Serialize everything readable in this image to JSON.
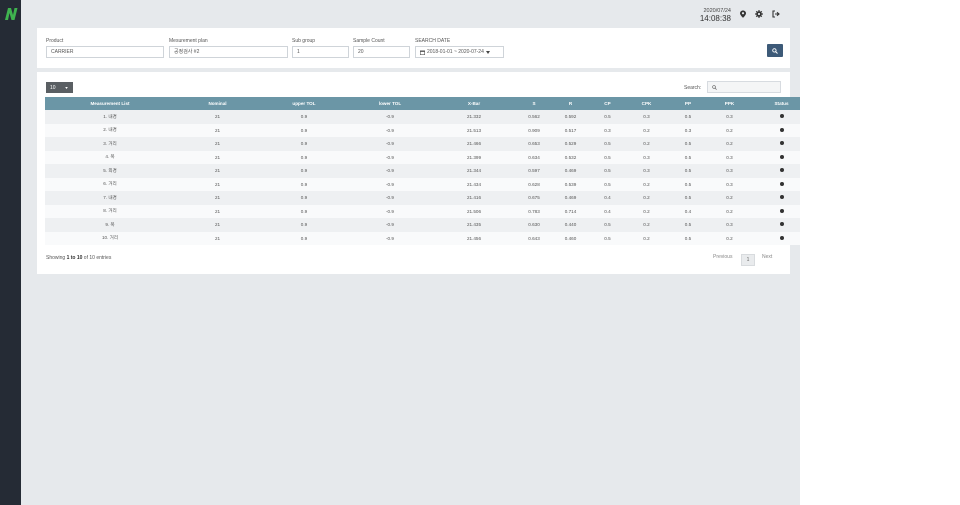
{
  "header": {
    "date": "2020/07/24",
    "time": "14:08:38"
  },
  "filters": {
    "product_label": "Product",
    "product_value": "CARRIER",
    "plan_label": "Mesurement plan",
    "plan_value": "공정검사 #2",
    "subgroup_label": "Sub group",
    "subgroup_value": "1",
    "sample_label": "Sample Count",
    "sample_value": "20",
    "date_label": "SEARCH DATE",
    "date_value": "2018-01-01 ~ 2020-07-24"
  },
  "table": {
    "page_length": "10",
    "search_label": "Search:",
    "columns": [
      "Measurement List",
      "Nominal",
      "upper TOL",
      "lower TOL",
      "X-Bar",
      "S",
      "R",
      "CP",
      "CPK",
      "PP",
      "PPK",
      "Status"
    ],
    "rows": [
      [
        "1. 내경",
        "21",
        "0.9",
        "-0.9",
        "21.332",
        "0.562",
        "0.592",
        "0.5",
        "0.3",
        "0.5",
        "0.3",
        ""
      ],
      [
        "2. 내경",
        "21",
        "0.9",
        "-0.9",
        "21.513",
        "0.909",
        "0.517",
        "0.3",
        "0.2",
        "0.3",
        "0.2",
        ""
      ],
      [
        "3. 거리",
        "21",
        "0.9",
        "-0.9",
        "21.466",
        "0.653",
        "0.529",
        "0.5",
        "0.2",
        "0.5",
        "0.2",
        ""
      ],
      [
        "4. 폭",
        "21",
        "0.9",
        "-0.9",
        "21.399",
        "0.634",
        "0.532",
        "0.5",
        "0.3",
        "0.5",
        "0.3",
        ""
      ],
      [
        "5. 외경",
        "21",
        "0.9",
        "-0.9",
        "21.344",
        "0.597",
        "0.469",
        "0.5",
        "0.3",
        "0.5",
        "0.3",
        ""
      ],
      [
        "6. 거리",
        "21",
        "0.9",
        "-0.9",
        "21.434",
        "0.628",
        "0.539",
        "0.5",
        "0.2",
        "0.5",
        "0.3",
        ""
      ],
      [
        "7. 내경",
        "21",
        "0.9",
        "-0.9",
        "21.416",
        "0.675",
        "0.469",
        "0.4",
        "0.2",
        "0.5",
        "0.2",
        ""
      ],
      [
        "8. 거리",
        "21",
        "0.9",
        "-0.9",
        "21.506",
        "0.783",
        "0.714",
        "0.4",
        "0.2",
        "0.4",
        "0.2",
        ""
      ],
      [
        "9. 폭",
        "21",
        "0.9",
        "-0.9",
        "21.435",
        "0.630",
        "0.440",
        "0.5",
        "0.2",
        "0.5",
        "0.3",
        ""
      ],
      [
        "10. 거리",
        "21",
        "0.9",
        "-0.9",
        "21.456",
        "0.643",
        "0.460",
        "0.5",
        "0.2",
        "0.5",
        "0.2",
        ""
      ]
    ],
    "info": {
      "prefix": "Showing ",
      "range": "1 to 10",
      "suffix": " of 10 entries"
    },
    "pager": {
      "previous": "Previous",
      "current": "1",
      "next": "Next"
    }
  },
  "icons": {
    "logo": "logo-icon",
    "location": "map-pin-icon",
    "settings": "gear-icon",
    "logout": "logout-icon",
    "search": "search-icon",
    "calendar": "calendar-icon",
    "dropdown": "caret-down-icon",
    "status": "status-dot-icon"
  },
  "colors": {
    "sidebar": "#252b35",
    "logo_green": "#3fb34f",
    "table_header": "#6b96a6",
    "search_button": "#3d5a78",
    "page_length_bg": "#5a5f63",
    "background": "#e6e9ec"
  }
}
